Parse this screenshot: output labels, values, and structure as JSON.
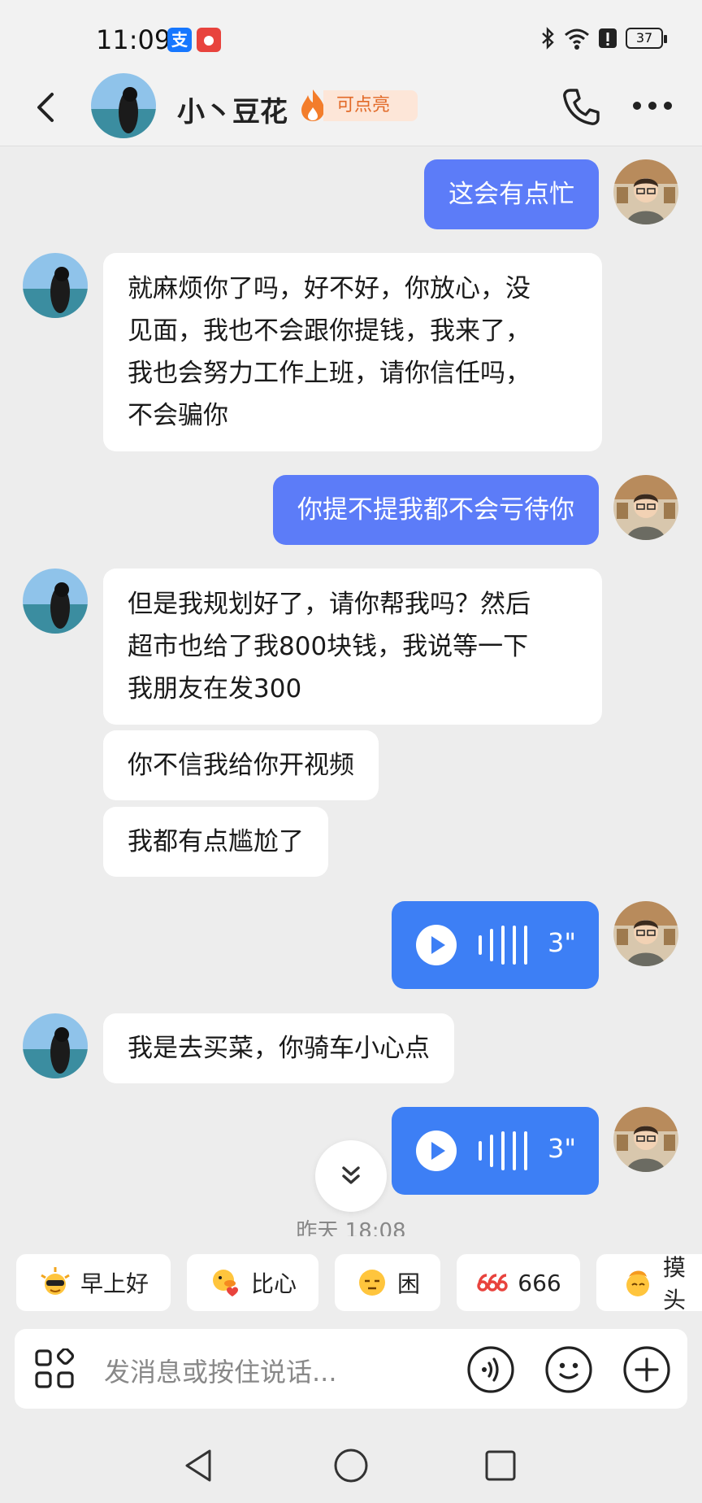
{
  "status_bar": {
    "time": "11:09",
    "app_icon_1": "支",
    "battery": "37"
  },
  "header": {
    "contact_name": "小丶豆花",
    "badge": "可点亮"
  },
  "messages": [
    {
      "side": "out",
      "text": "这会有点忙"
    },
    {
      "side": "in",
      "lines": [
        "就麻烦你了吗，好不好，你放心，没",
        "见面，我也不会跟你提钱，我来了，",
        "我也会努力工作上班，请你信任吗，",
        "不会骗你"
      ]
    },
    {
      "side": "out",
      "text": "你提不提我都不会亏待你"
    },
    {
      "side": "in",
      "lines": [
        "但是我规划好了，请你帮我吗？然后",
        "超市也给了我800块钱，我说等一下",
        "我朋友在发300"
      ]
    },
    {
      "side": "in",
      "text": "你不信我给你开视频"
    },
    {
      "side": "in",
      "text": "我都有点尴尬了"
    },
    {
      "side": "out",
      "type": "voice",
      "duration": "3\""
    },
    {
      "side": "in",
      "text": "我是去买菜，你骑车小心点"
    },
    {
      "side": "out",
      "type": "voice",
      "duration": "3\""
    }
  ],
  "timestamp": "昨天 18:08",
  "quick_replies": [
    {
      "label": "早上好",
      "icon": "sun-sunglasses-emoji"
    },
    {
      "label": "比心",
      "icon": "duck-heart-emoji"
    },
    {
      "label": "困",
      "icon": "sleepy-face-emoji"
    },
    {
      "label": "666",
      "icon": "666-sticker"
    },
    {
      "label": "摸头",
      "icon": "pat-head-emoji"
    }
  ],
  "input": {
    "placeholder": "发消息或按住说话..."
  },
  "colors": {
    "out_bubble": "#5c7cf8",
    "voice_bubble": "#3d7ff5",
    "badge_bg": "#fde6d8",
    "badge_text": "#e26a28"
  }
}
